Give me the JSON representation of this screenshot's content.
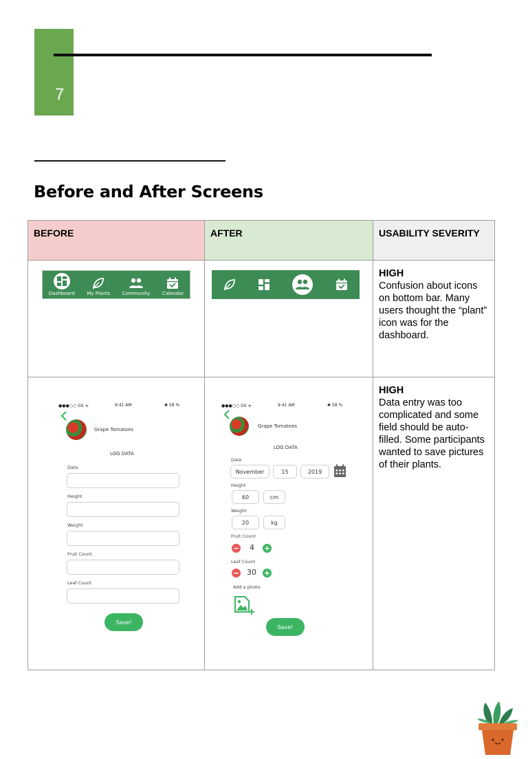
{
  "page": {
    "number": "7",
    "section_title": "Before and After Screens"
  },
  "table": {
    "headers": {
      "before": "BEFORE",
      "after": "AFTER",
      "severity": "USABILITY SEVERITY"
    },
    "rows": [
      {
        "level": "HIGH",
        "text": "Confusion about icons on bottom bar. Many users thought the “plant” icon was for the dashboard."
      },
      {
        "level": "HIGH",
        "text": "Data entry was too complicated and some field should be auto-filled. Some participants wanted to save pictures of their plants."
      }
    ]
  },
  "before_nav": {
    "items": [
      {
        "label": "Dashboard",
        "icon": "dashboard-icon"
      },
      {
        "label": "My Plants",
        "icon": "leaf-icon"
      },
      {
        "label": "Community",
        "icon": "people-icon"
      },
      {
        "label": "Calendar",
        "icon": "calendar-icon"
      }
    ]
  },
  "after_nav": {
    "items": [
      "leaf-icon",
      "dashboard-icon",
      "people-icon",
      "calendar-icon"
    ]
  },
  "phone": {
    "carrier": "●●●○○ GS ᯤ",
    "time": "9:41 AM",
    "battery": "✱ 58 %",
    "plant_name": "Grape Tomatoes",
    "log_title": "LOG DATA",
    "save_label": "Save!"
  },
  "before_form": {
    "labels": [
      "Date",
      "Height",
      "Weight",
      "Fruit Count",
      "Leaf Count"
    ]
  },
  "after_form": {
    "date_label": "Date",
    "month": "November",
    "day": "15",
    "year": "2019",
    "height_label": "Height",
    "height_value": "60",
    "height_unit": "cm",
    "weight_label": "Weight",
    "weight_value": "20",
    "weight_unit": "kg",
    "fruit_label": "Fruit Count",
    "fruit_value": "4",
    "leaf_label": "Leaf Count",
    "leaf_value": "30",
    "photo_label": "Add a photo"
  },
  "colors": {
    "accent": "#6aa84f",
    "nav_green": "#3d8b55",
    "before_header": "#f4cccc",
    "after_header": "#d9ead3",
    "severity_header": "#efefef",
    "save_green": "#3cb563",
    "minus_red": "#e85a5a"
  }
}
